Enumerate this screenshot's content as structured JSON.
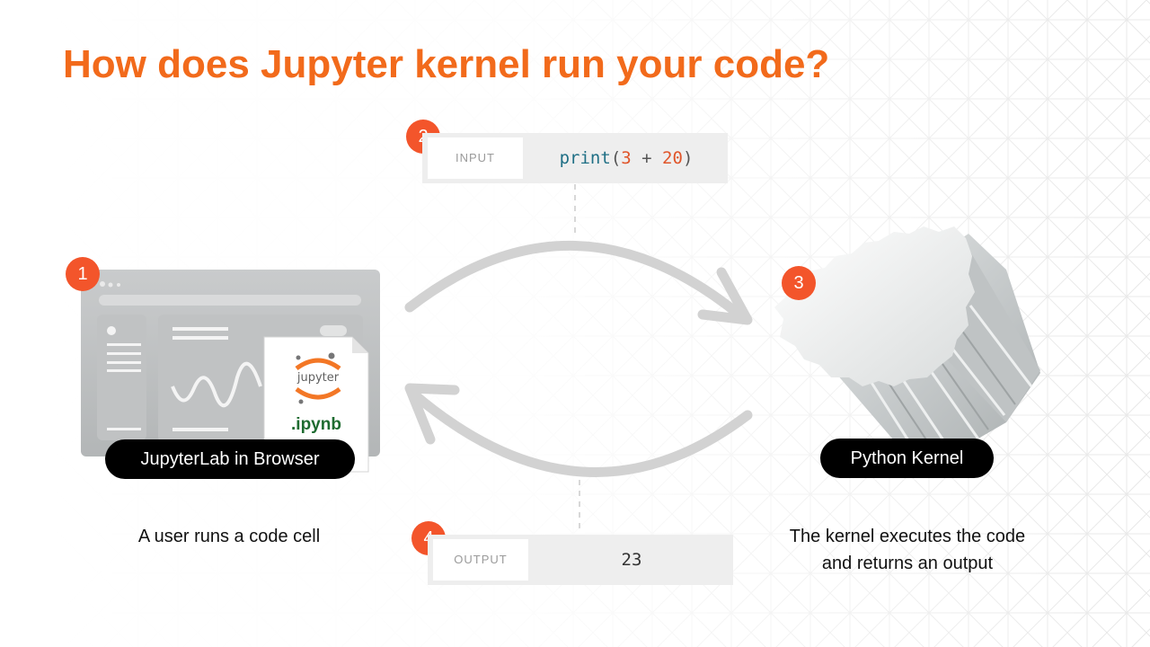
{
  "title": "How does Jupyter kernel run your code?",
  "steps": {
    "one": "1",
    "two": "2",
    "three": "3",
    "four": "4"
  },
  "input_box": {
    "label": "INPUT",
    "code": {
      "fn": "print",
      "open": "(",
      "a": "3",
      "op": " + ",
      "b": "20",
      "close": ")"
    }
  },
  "output_box": {
    "label": "OUTPUT",
    "value": "23"
  },
  "browser": {
    "logo_text": "jupyter",
    "file_ext": ".ipynb",
    "pill": "JupyterLab in Browser",
    "caption": "A user runs a code cell"
  },
  "kernel": {
    "pill": "Python Kernel",
    "caption_line1": "The kernel executes the code",
    "caption_line2": "and returns an output"
  },
  "colors": {
    "accent": "#f26a1b",
    "badge": "#f3552b",
    "pill": "#000000",
    "jupyter_orange": "#f37726",
    "ipynb_green": "#1e6b30"
  }
}
